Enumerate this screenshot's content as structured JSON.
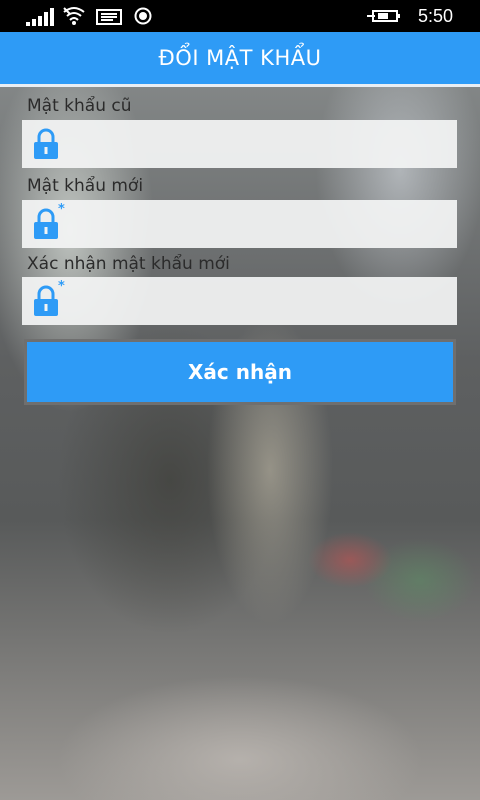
{
  "status_bar": {
    "time": "5:50",
    "icons": [
      "signal-icon",
      "wifi-icon",
      "message-icon",
      "record-icon",
      "battery-charging-icon"
    ]
  },
  "header": {
    "title": "ĐỔI MẬT KHẨU"
  },
  "form": {
    "old_password": {
      "label": "Mật khẩu cũ",
      "value": "",
      "icon": "lock-icon"
    },
    "new_password": {
      "label": "Mật khẩu mới",
      "value": "",
      "icon": "lock-required-icon",
      "required_mark": "*"
    },
    "confirm_password": {
      "label": "Xác nhận mật khẩu mới",
      "value": "",
      "icon": "lock-required-icon",
      "required_mark": "*"
    },
    "submit_label": "Xác nhận"
  },
  "colors": {
    "accent": "#2e9bf6",
    "header_text": "#ffffff",
    "field_bg": "#f3f4f4",
    "button_border": "#6f6f6f"
  }
}
